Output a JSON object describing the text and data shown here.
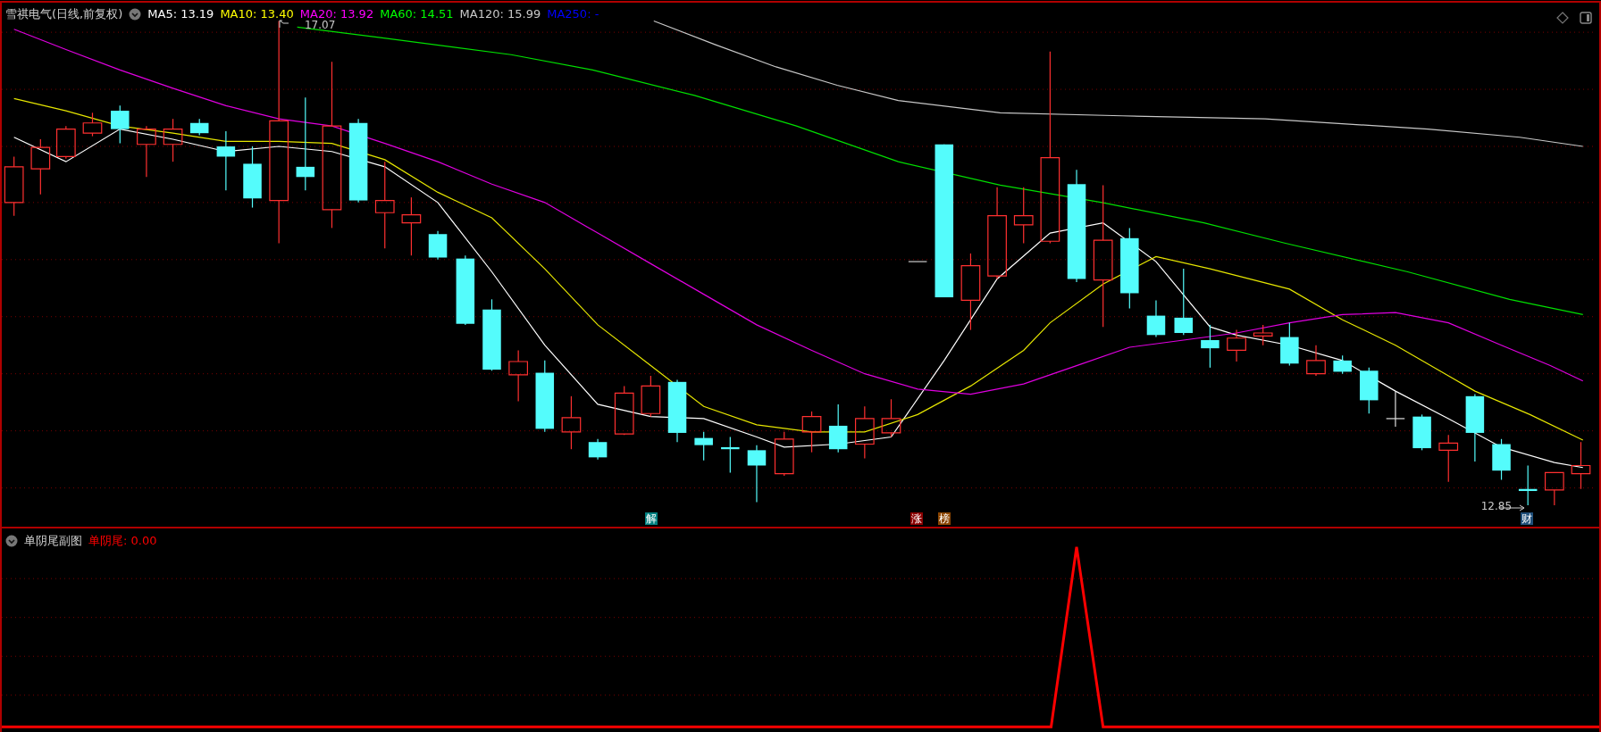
{
  "main_panel": {
    "title": "雪祺电气(日线,前复权)",
    "indicators": [
      {
        "label": "MA5: 13.19",
        "color": "#ffffff"
      },
      {
        "label": "MA10: 13.40",
        "color": "#ffff00"
      },
      {
        "label": "MA20: 13.92",
        "color": "#ff00ff"
      },
      {
        "label": "MA60: 14.51",
        "color": "#00ff00"
      },
      {
        "label": "MA120: 15.99",
        "color": "#c8c8c8"
      },
      {
        "label": "MA250: -",
        "color": "#0000ff"
      }
    ],
    "price_labels": [
      {
        "kind": "high",
        "text": "17.07"
      },
      {
        "kind": "low",
        "text": "12.85"
      }
    ],
    "event_markers": [
      {
        "text": "解",
        "color": "#008080"
      },
      {
        "text": "涨",
        "color": "#8b0000"
      },
      {
        "text": "榜",
        "color": "#8b4500"
      },
      {
        "text": "财",
        "color": "#1f4e79"
      }
    ]
  },
  "sub_panel": {
    "title": "单阴尾副图",
    "indicators": [
      {
        "label": "单阴尾: 0.00",
        "color": "#ff0000"
      }
    ]
  }
}
